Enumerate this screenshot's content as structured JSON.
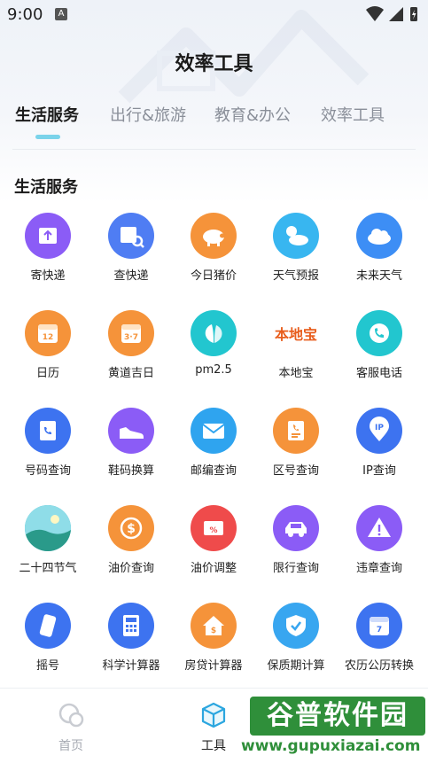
{
  "status": {
    "time": "9:00",
    "indicator": "A"
  },
  "title": "效率工具",
  "tabs": [
    {
      "label": "生活服务",
      "active": true
    },
    {
      "label": "出行&旅游",
      "active": false
    },
    {
      "label": "教育&办公",
      "active": false
    },
    {
      "label": "效率工具",
      "active": false
    }
  ],
  "section_title": "生活服务",
  "tools": [
    {
      "label": "寄快递",
      "icon": "parcel-send-icon",
      "color": "#8b5cf6"
    },
    {
      "label": "查快递",
      "icon": "parcel-search-icon",
      "color": "#4f7df3"
    },
    {
      "label": "今日猪价",
      "icon": "pig-icon",
      "color": "#f5933a"
    },
    {
      "label": "天气预报",
      "icon": "weather-sun-cloud-icon",
      "color": "#38b6f0"
    },
    {
      "label": "未来天气",
      "icon": "cloud-icon",
      "color": "#3d8ef5"
    },
    {
      "label": "日历",
      "icon": "calendar-icon",
      "color": "#f5933a",
      "icon_text": "12"
    },
    {
      "label": "黄道吉日",
      "icon": "calendar-lucky-icon",
      "color": "#f5933a",
      "icon_text": "3·7"
    },
    {
      "label": "pm2.5",
      "icon": "leaf-icon",
      "color": "#22c6cf"
    },
    {
      "label": "本地宝",
      "icon": "bendibao-logo-icon",
      "color": "#e85d1c",
      "icon_text": "本地宝"
    },
    {
      "label": "客服电话",
      "icon": "phone-icon",
      "color": "#22c6cf"
    },
    {
      "label": "号码查询",
      "icon": "phonebook-icon",
      "color": "#3d73f0"
    },
    {
      "label": "鞋码换算",
      "icon": "shoe-icon",
      "color": "#8b5cf6"
    },
    {
      "label": "邮编查询",
      "icon": "mail-icon",
      "color": "#2fa4ef"
    },
    {
      "label": "区号查询",
      "icon": "document-phone-icon",
      "color": "#f5933a"
    },
    {
      "label": "IP查询",
      "icon": "location-pin-icon",
      "color": "#3d73f0",
      "icon_text": "IP"
    },
    {
      "label": "二十四节气",
      "icon": "landscape-icon",
      "color": "#2fb3c9"
    },
    {
      "label": "油价查询",
      "icon": "coin-icon",
      "color": "#f5933a",
      "icon_text": "$"
    },
    {
      "label": "油价调整",
      "icon": "percent-tag-icon",
      "color": "#ef4b4b",
      "icon_text": "%"
    },
    {
      "label": "限行查询",
      "icon": "car-icon",
      "color": "#8b5cf6"
    },
    {
      "label": "违章查询",
      "icon": "warning-icon",
      "color": "#8b5cf6"
    },
    {
      "label": "摇号",
      "icon": "phone-shake-icon",
      "color": "#3d73f0"
    },
    {
      "label": "科学计算器",
      "icon": "calculator-icon",
      "color": "#3d73f0"
    },
    {
      "label": "房贷计算器",
      "icon": "house-coin-icon",
      "color": "#f5933a",
      "icon_text": "$"
    },
    {
      "label": "保质期计算",
      "icon": "shield-check-icon",
      "color": "#38a6f0"
    },
    {
      "label": "农历公历转换",
      "icon": "calendar-convert-icon",
      "color": "#3d73f0",
      "icon_text": "7"
    }
  ],
  "bottom_nav": [
    {
      "label": "首页",
      "icon": "home-bubbles-icon",
      "active": false
    },
    {
      "label": "工具",
      "icon": "box-icon",
      "active": true
    }
  ],
  "watermark": {
    "name": "谷普软件园",
    "url": "www.gupuxiazai.com"
  }
}
